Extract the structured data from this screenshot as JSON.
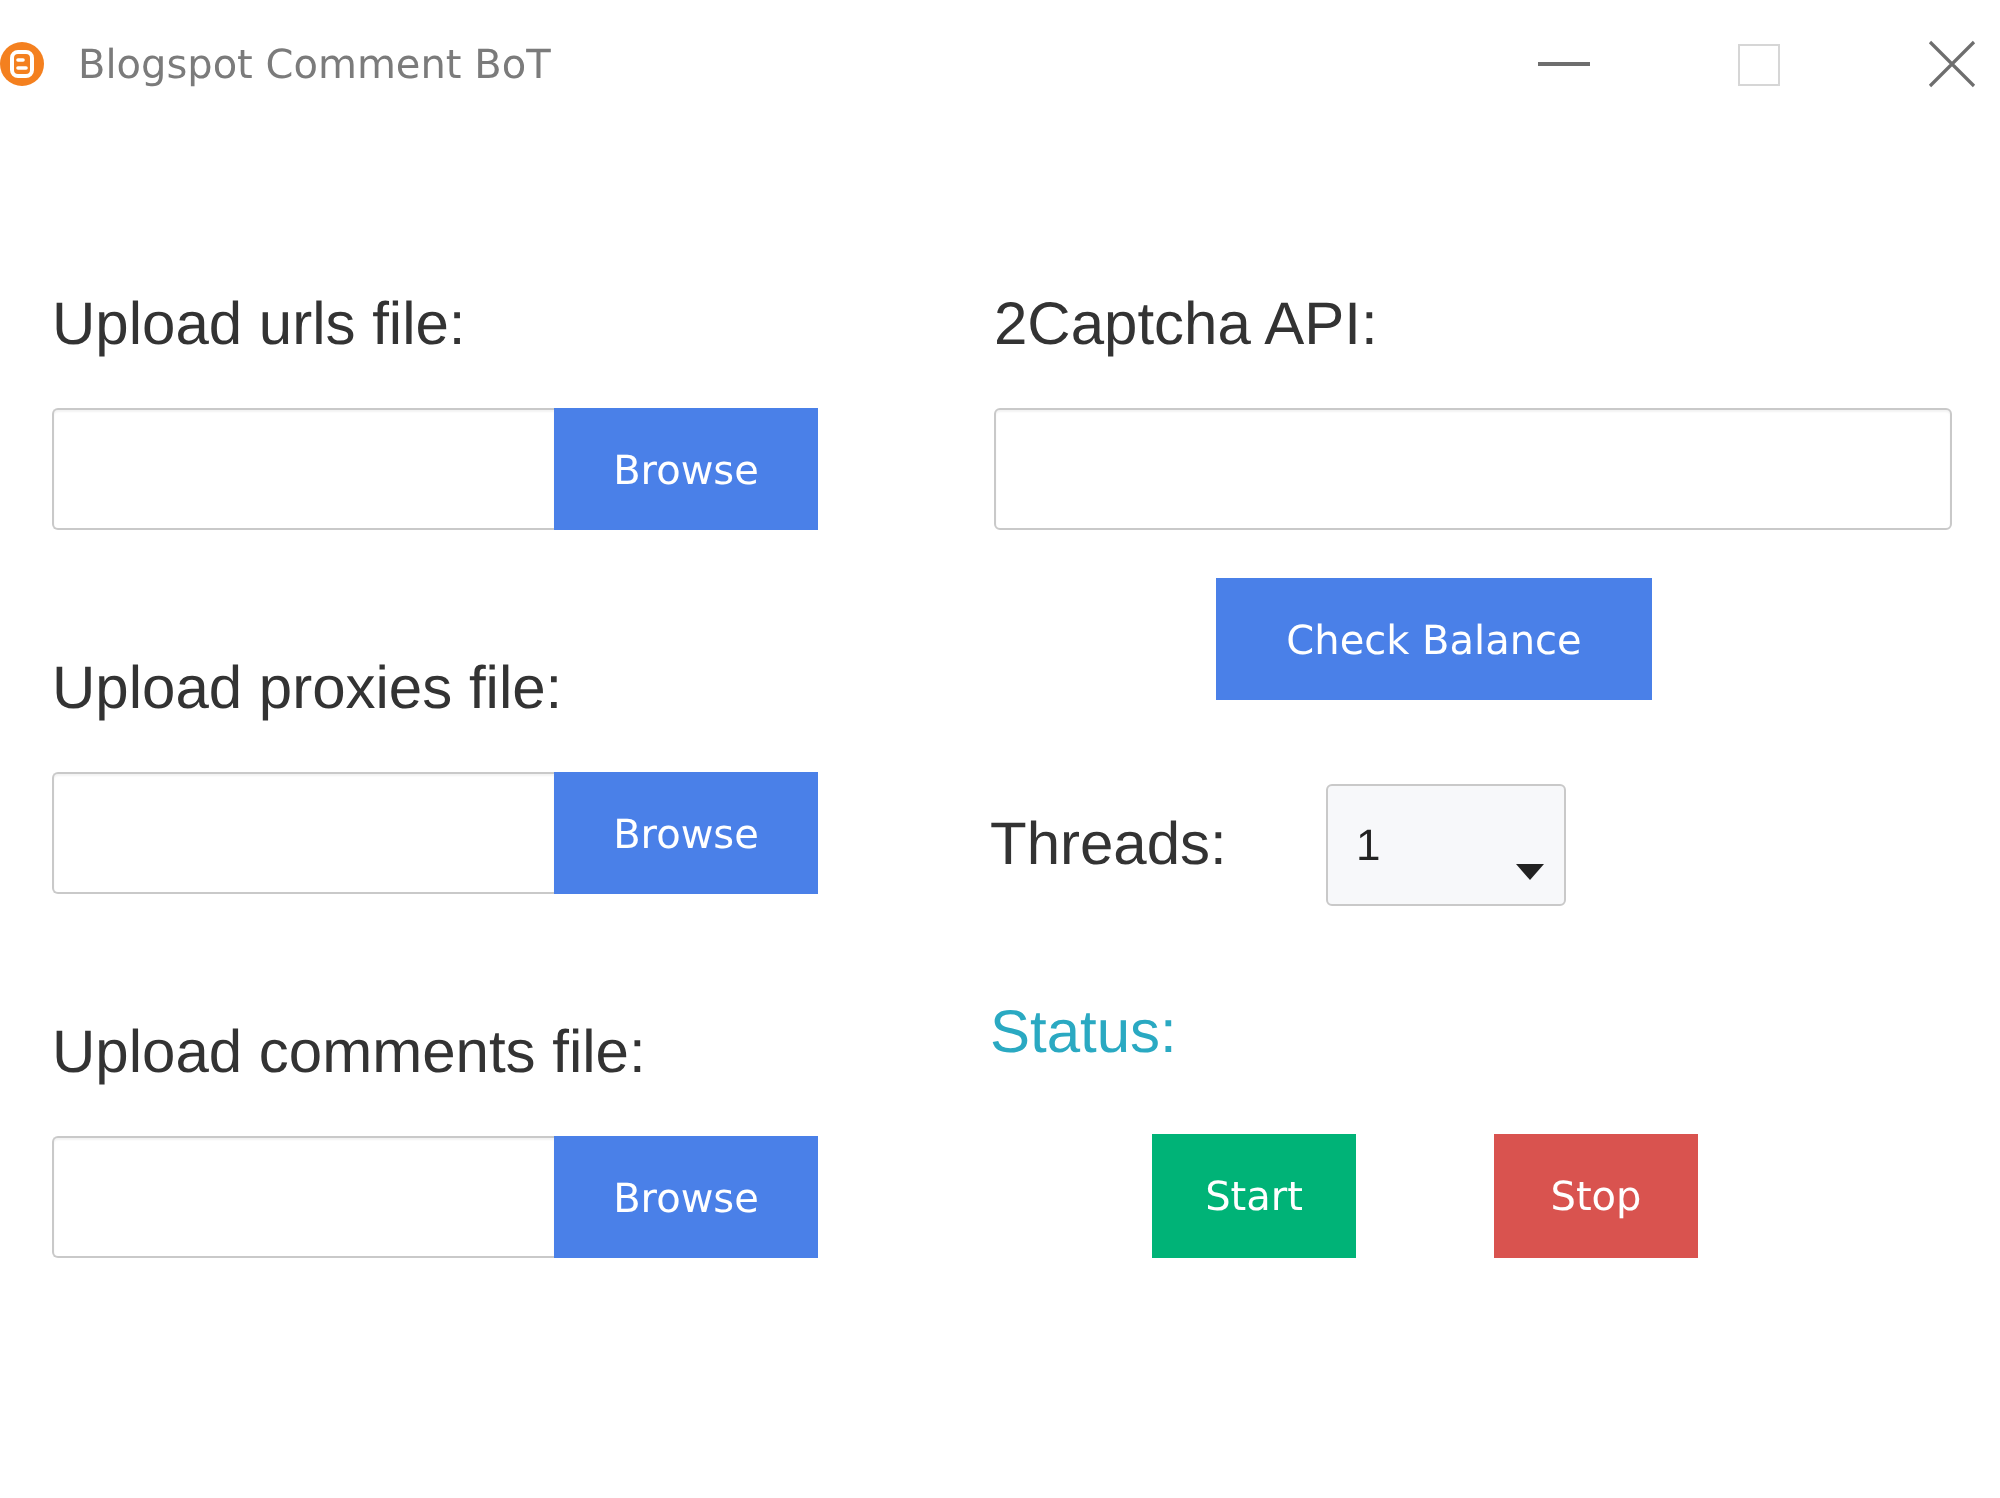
{
  "window": {
    "title": "Blogspot Comment BoT",
    "controls": [
      {
        "kind": "minimize",
        "disabled": false
      },
      {
        "kind": "maximize",
        "disabled": true
      },
      {
        "kind": "close",
        "disabled": false
      }
    ]
  },
  "uploads": [
    {
      "label": "Upload urls file:",
      "button": "Browse"
    },
    {
      "label": "Upload proxies file:",
      "button": "Browse"
    },
    {
      "label": "Upload comments file:",
      "button": "Browse"
    }
  ],
  "captcha": {
    "label": "2Captcha API:",
    "button": "Check Balance"
  },
  "threads": {
    "label": "Threads:",
    "value": "1"
  },
  "status": {
    "label": "Status:"
  },
  "actions": [
    {
      "label": "Start",
      "color": "#00b377"
    },
    {
      "label": "Stop",
      "color": "#d9534f"
    }
  ]
}
